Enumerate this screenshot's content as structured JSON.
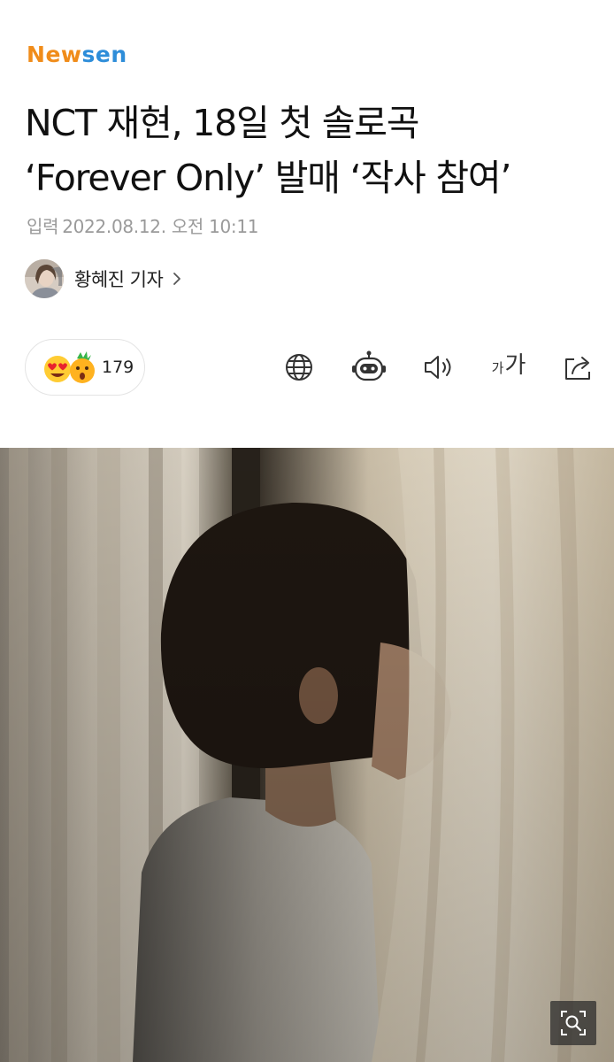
{
  "brand": {
    "logo_n": "N",
    "logo_ew": "ew",
    "logo_sen": "sen"
  },
  "article": {
    "headline_line1": "NCT 재현, 18일 첫 솔로곡",
    "headline_line2": "‘Forever Only’ 발매 ‘작사 참여’",
    "date_label": "입력",
    "date_value": "2022.08.12. 오전 10:11",
    "author": "황혜진 기자"
  },
  "reactions": {
    "emojis": [
      "heart-eyes-emoji",
      "surprised-pineapple-emoji"
    ],
    "count": "179"
  },
  "toolbar": {
    "items": [
      "globe-icon",
      "robot-icon",
      "speaker-icon",
      "font-size-icon",
      "share-icon"
    ],
    "font_small": "가",
    "font_big": "가"
  },
  "media": {
    "image": "curtain-portrait-photo",
    "zoom_icon": "zoom-search-icon"
  },
  "colors": {
    "logo_orange": "#f08c1a",
    "logo_blue": "#2e8dd9",
    "date_gray": "#9a9a9a",
    "icon_gray": "#333333"
  }
}
